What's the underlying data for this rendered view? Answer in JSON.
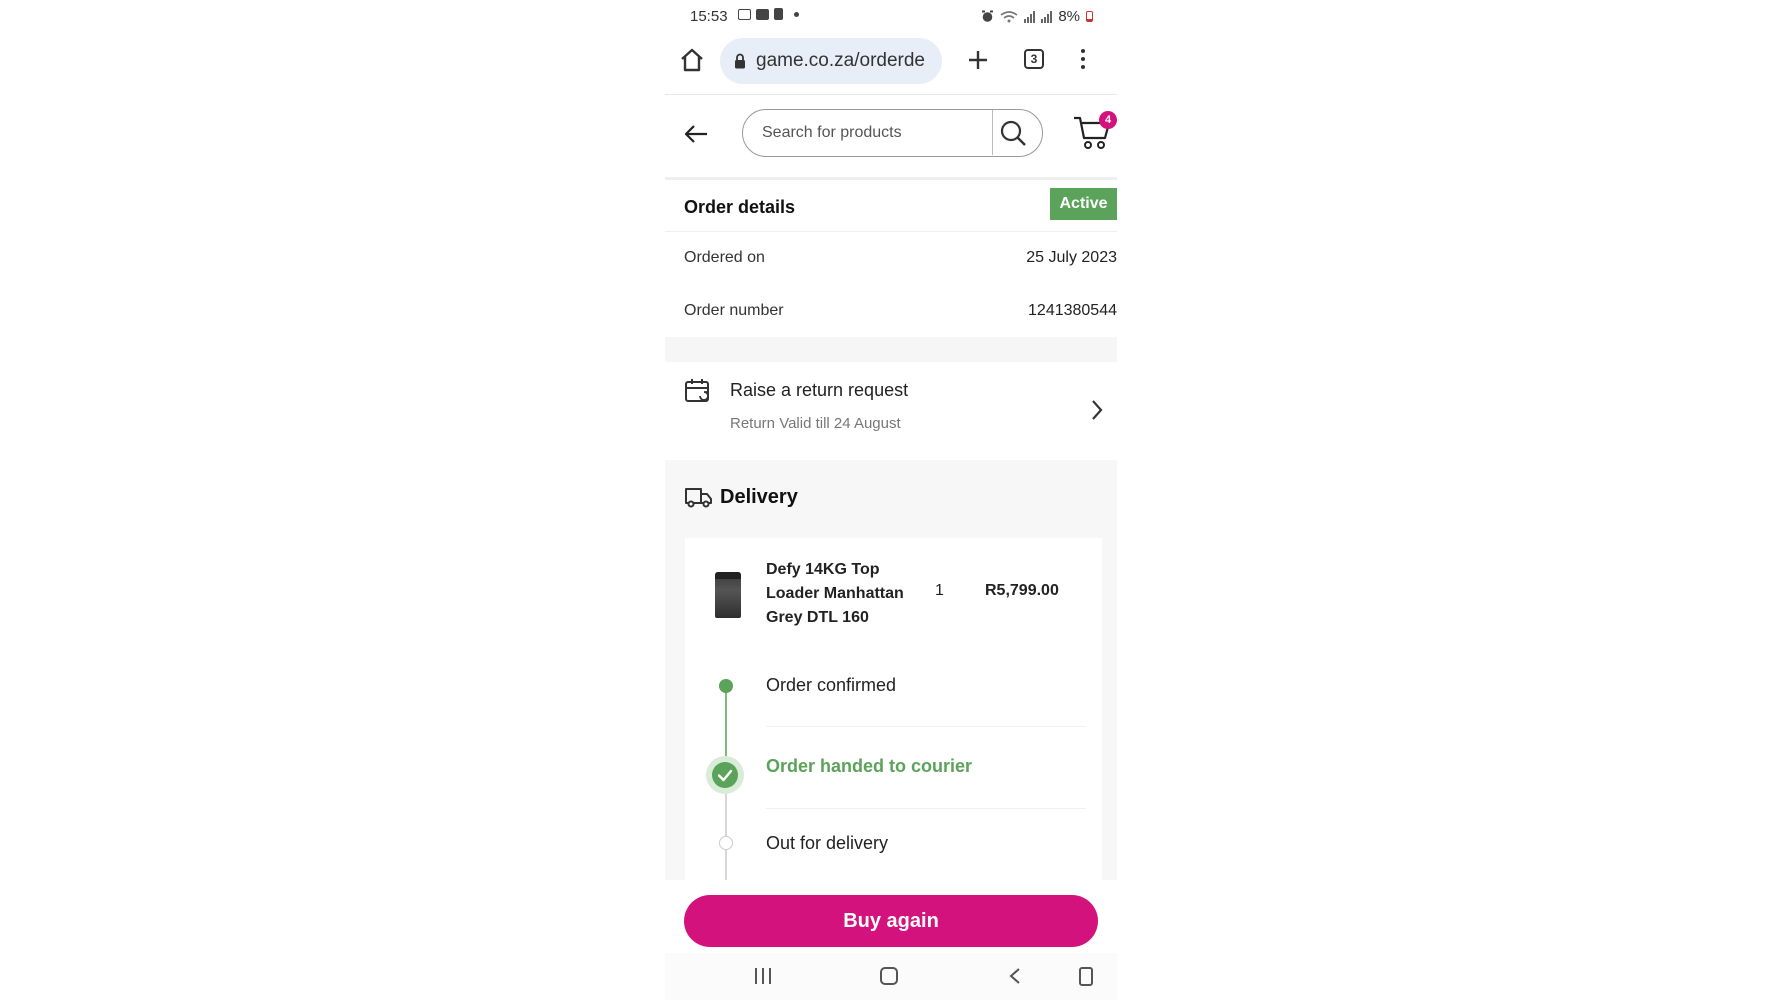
{
  "status_bar": {
    "time": "15:53",
    "battery": "8%",
    "icons": [
      "screen-icon",
      "gallery-icon",
      "clipboard-icon",
      "dot-icon",
      "alarm-icon",
      "wifi-icon",
      "signal-icon",
      "signal-icon",
      "battery-icon"
    ]
  },
  "browser": {
    "url": "game.co.za/orderde",
    "tab_count": "3",
    "icons": [
      "home-icon",
      "lock-icon",
      "plus-icon",
      "tabs-icon",
      "more-icon"
    ]
  },
  "header": {
    "search_placeholder": "Search for products",
    "cart_count": "4",
    "icons": [
      "back-arrow-icon",
      "search-icon",
      "cart-icon"
    ]
  },
  "order_details": {
    "title": "Order details",
    "status": "Active",
    "rows": [
      {
        "label": "Ordered on",
        "value": "25 July 2023"
      },
      {
        "label": "Order number",
        "value": "1241380544"
      }
    ]
  },
  "return_request": {
    "title": "Raise a return request",
    "subtitle": "Return Valid till 24 August",
    "icons": [
      "return-icon",
      "chevron-right-icon"
    ]
  },
  "delivery": {
    "title": "Delivery",
    "product": {
      "name": "Defy 14KG Top Loader Manhattan Grey DTL 160",
      "qty": "1",
      "price": "R5,799.00"
    },
    "timeline": [
      {
        "label": "Order confirmed",
        "state": "done"
      },
      {
        "label": "Order handed to courier",
        "state": "current"
      },
      {
        "label": "Out for delivery",
        "state": "pending"
      }
    ]
  },
  "buy_again": "Buy again",
  "colors": {
    "brand_pink": "#d4127d",
    "status_green": "#5ba35a",
    "url_bar": "#e7eef8"
  }
}
